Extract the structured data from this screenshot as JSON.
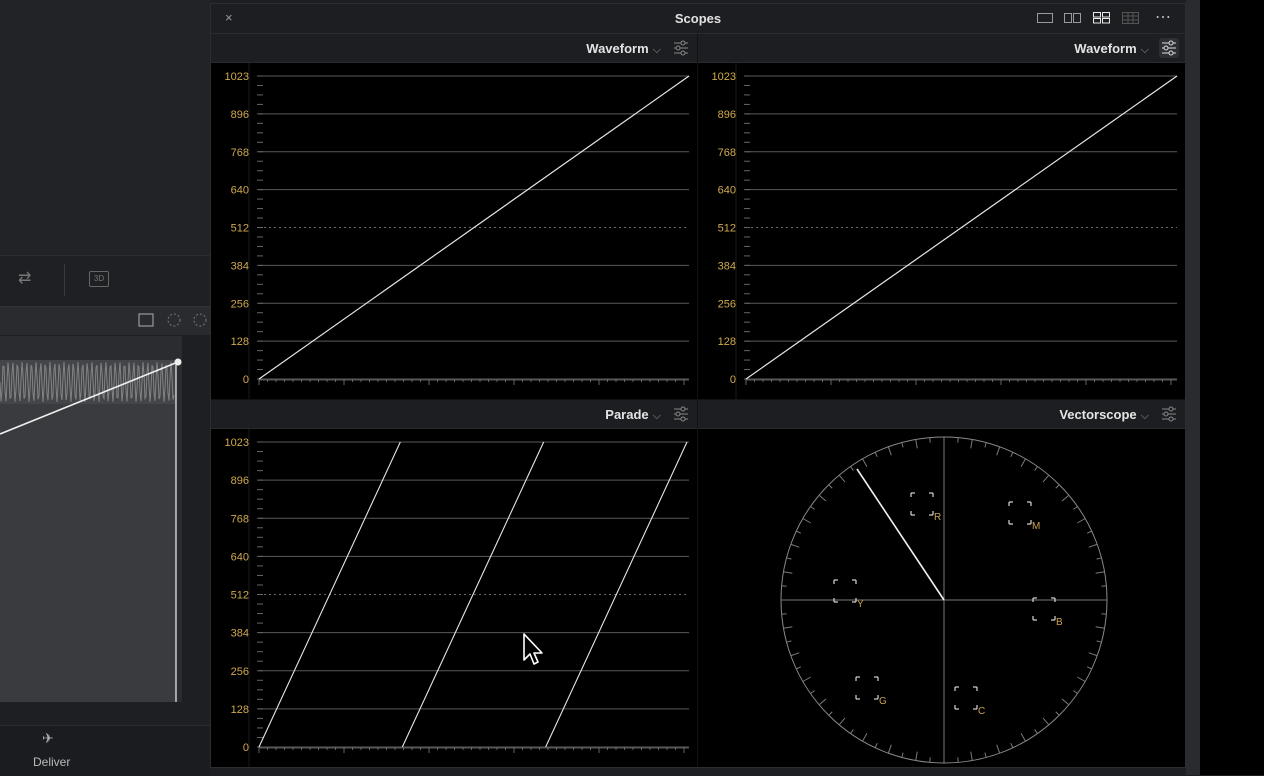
{
  "window": {
    "title": "Scopes",
    "close_glyph": "×",
    "more_glyph": "⋯",
    "layout_options": [
      "single-icon",
      "dual-icon",
      "quad-icon",
      "grid-icon"
    ]
  },
  "panes": [
    {
      "scope": "Waveform",
      "chevron": "⌵"
    },
    {
      "scope": "Waveform",
      "chevron": "⌵"
    },
    {
      "scope": "Parade",
      "chevron": "⌵"
    },
    {
      "scope": "Vectorscope",
      "chevron": "⌵"
    }
  ],
  "y_ticks": [
    "1023",
    "896",
    "768",
    "640",
    "512",
    "384",
    "256",
    "128",
    "0"
  ],
  "vectorscope_targets": [
    "R",
    "M",
    "B",
    "C",
    "G",
    "Y"
  ],
  "background": {
    "deliver_label": "Deliver",
    "badge_3d": "3D"
  },
  "colors": {
    "scale_label": "#d0a94f",
    "trace": "#e6e6e6"
  }
}
